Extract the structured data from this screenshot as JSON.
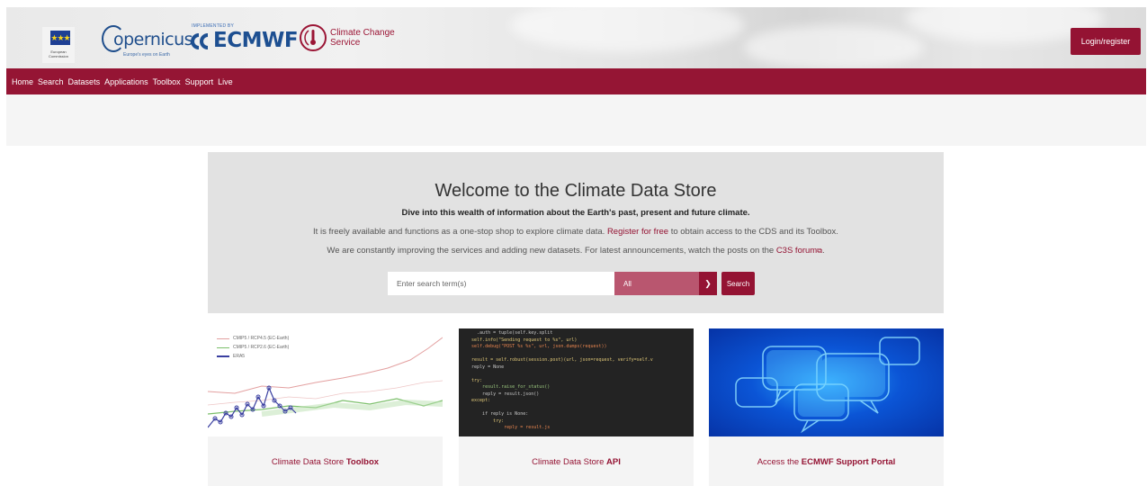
{
  "header": {
    "eu_logo": {
      "text": "European Commission"
    },
    "copernicus_logo": {
      "name": "opernicus",
      "tagline": "Europe's eyes on Earth"
    },
    "ecmwf_logo": {
      "implemented_by": "IMPLEMENTED BY",
      "name": "ECMWF"
    },
    "c3s_logo": {
      "line1": "Climate Change",
      "line2": "Service"
    },
    "login_label": "Login/register"
  },
  "nav": {
    "items": [
      {
        "label": "Home"
      },
      {
        "label": "Search"
      },
      {
        "label": "Datasets"
      },
      {
        "label": "Applications"
      },
      {
        "label": "Toolbox"
      },
      {
        "label": "Support"
      },
      {
        "label": "Live"
      }
    ]
  },
  "hero": {
    "title": "Welcome to the Climate Data Store",
    "subtitle": "Dive into this wealth of information about the Earth's past, present and future climate.",
    "line1_pre": "It is freely available and functions as a one-stop shop to explore climate data. ",
    "line1_link": "Register for free",
    "line1_post": " to obtain access to the CDS and its Toolbox.",
    "line2_pre": "We are constantly improving the services and adding new datasets. For latest announcements, watch the posts on the ",
    "line2_link": "C3S forum",
    "line2_post": "."
  },
  "search": {
    "placeholder": "Enter search term(s)",
    "select_value": "All",
    "button_label": "Search"
  },
  "cards": [
    {
      "caption_pre": "Climate Data Store ",
      "caption_bold": "Toolbox"
    },
    {
      "caption_pre": "Climate Data Store ",
      "caption_bold": "API"
    },
    {
      "caption_pre": "Access the ",
      "caption_bold": "ECMWF Support Portal"
    }
  ],
  "toolbox_chart": {
    "legend": [
      {
        "name": "CMIP5 / RCP4.5 (EC-Earth)",
        "color": "#d99"
      },
      {
        "name": "CMIP5 / RCP2.6 (EC-Earth)",
        "color": "#7bbf6a"
      },
      {
        "name": "ERA5",
        "color": "#3a3fa0"
      }
    ]
  },
  "code_snippet": [
    "    .auth = tuple(self.key.split",
    "  self.info(\"Sending request to %s\", url)",
    "  self.debug(\"POST %s %s\", url, json.dumps(request))",
    "",
    "  result = self.robust(session.post)(url, json=request, verify=self.v",
    "  reply = None",
    "",
    "  try:",
    "      result.raise_for_status()",
    "      reply = result.json()",
    "  except:",
    "",
    "      if reply is None:",
    "          try:",
    "              reply = result.js"
  ],
  "colors": {
    "brand": "#941333",
    "nav_bg": "#951534",
    "hero_bg": "#e2e2e2"
  }
}
